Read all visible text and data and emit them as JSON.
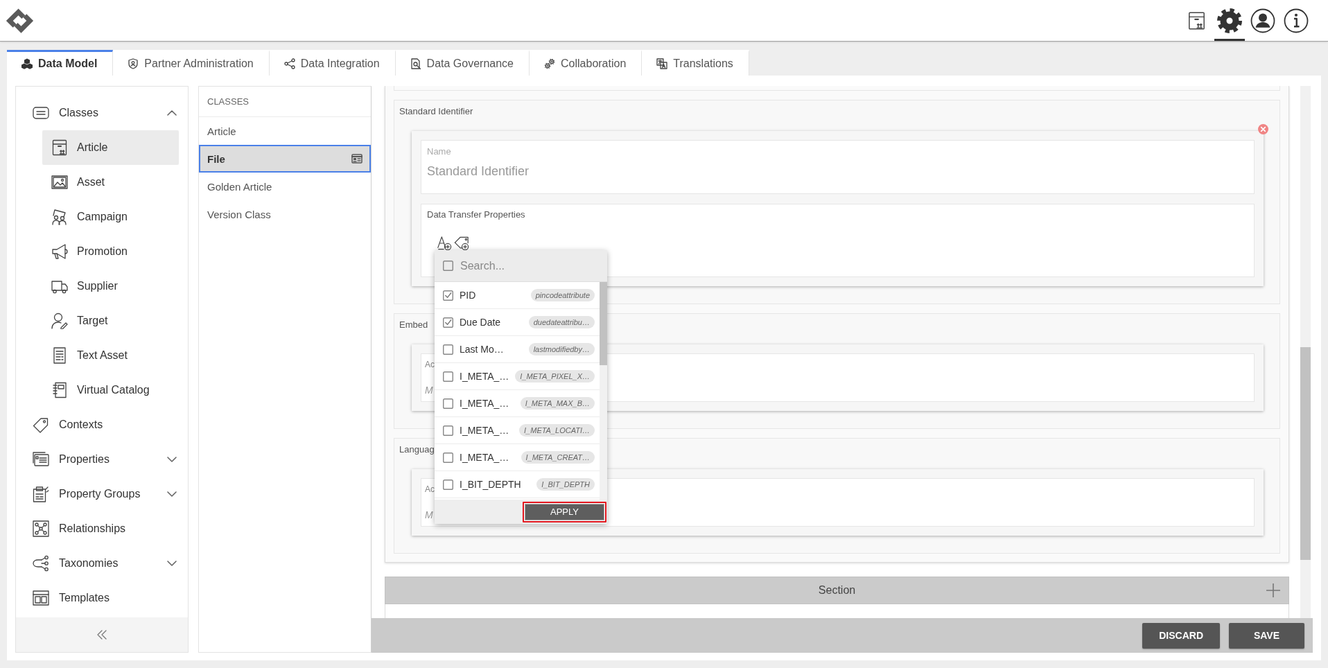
{
  "header": {
    "toolbar": [
      {
        "selected": false
      },
      {
        "selected": true
      },
      {
        "selected": false
      },
      {
        "selected": false
      }
    ]
  },
  "tabs": [
    {
      "label": "Data Model",
      "selected": true
    },
    {
      "label": "Partner Administration",
      "selected": false
    },
    {
      "label": "Data Integration",
      "selected": false
    },
    {
      "label": "Data Governance",
      "selected": false
    },
    {
      "label": "Collaboration",
      "selected": false
    },
    {
      "label": "Translations",
      "selected": false
    }
  ],
  "sidebar": {
    "items": [
      {
        "label": "Classes",
        "kind": "group",
        "expanded": true,
        "selected": false,
        "children": [
          {
            "label": "Article",
            "selected": true
          },
          {
            "label": "Asset",
            "selected": false
          },
          {
            "label": "Campaign",
            "selected": false
          },
          {
            "label": "Promotion",
            "selected": false
          },
          {
            "label": "Supplier",
            "selected": false
          },
          {
            "label": "Target",
            "selected": false
          },
          {
            "label": "Text Asset",
            "selected": false
          },
          {
            "label": "Virtual Catalog",
            "selected": false
          }
        ]
      },
      {
        "label": "Contexts",
        "kind": "link",
        "selected": false
      },
      {
        "label": "Properties",
        "kind": "group",
        "expanded": false,
        "selected": false
      },
      {
        "label": "Property Groups",
        "kind": "group",
        "expanded": false,
        "selected": false
      },
      {
        "label": "Relationships",
        "kind": "link",
        "selected": false
      },
      {
        "label": "Taxonomies",
        "kind": "group",
        "expanded": false,
        "selected": false
      },
      {
        "label": "Templates",
        "kind": "link",
        "selected": false
      }
    ]
  },
  "classes": {
    "heading": "CLASSES",
    "items": [
      {
        "label": "Article",
        "selected": false
      },
      {
        "label": "File",
        "selected": true
      },
      {
        "label": "Golden Article",
        "selected": false
      },
      {
        "label": "Version Class",
        "selected": false
      }
    ]
  },
  "editor": {
    "sections": [
      {
        "kind": "identifier",
        "title": "Standard Identifier",
        "name_field": {
          "label": "Name",
          "value": "Standard Identifier"
        },
        "properties": {
          "label": "Data Transfer Properties",
          "dropdown": {
            "select_all_checked": false,
            "search_placeholder": "Search...",
            "options": [
              {
                "label": "PID",
                "tag": "pincodeattribute",
                "checked": true
              },
              {
                "label": "Due Date",
                "tag": "duedateattribu…",
                "checked": true
              },
              {
                "label": "Last Mo…",
                "tag": "lastmodifiedby…",
                "checked": false
              },
              {
                "label": "I_META_…",
                "tag": "I_META_PIXEL_X…",
                "checked": false
              },
              {
                "label": "I_META_…",
                "tag": "I_META_MAX_B…",
                "checked": false
              },
              {
                "label": "I_META_…",
                "tag": "I_META_LOCATI…",
                "checked": false
              },
              {
                "label": "I_META_…",
                "tag": "I_META_CREAT…",
                "checked": false
              },
              {
                "label": "I_BIT_DEPTH",
                "tag": "I_BIT_DEPTH",
                "checked": false
              }
            ],
            "apply": {
              "label": "APPLY",
              "highlighted": true
            }
          }
        }
      },
      {
        "kind": "attributes",
        "title": "Embed",
        "field": {
          "label": "Ac",
          "placeholder": "M"
        }
      },
      {
        "kind": "attributes",
        "title": "Languag",
        "field": {
          "label": "Ac",
          "placeholder": "M"
        }
      }
    ],
    "section_bar": {
      "label": "Section"
    }
  },
  "actions": [
    {
      "label": "DISCARD"
    },
    {
      "label": "SAVE"
    }
  ]
}
